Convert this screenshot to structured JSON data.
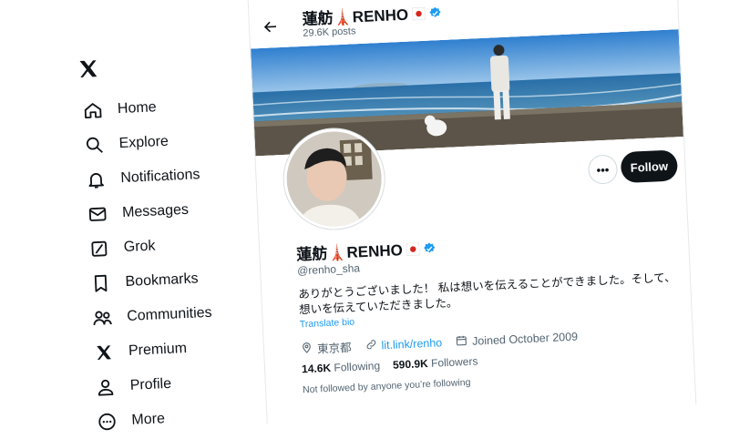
{
  "nav": {
    "items": [
      {
        "label": "Home",
        "icon": "home-icon"
      },
      {
        "label": "Explore",
        "icon": "search-icon"
      },
      {
        "label": "Notifications",
        "icon": "bell-icon"
      },
      {
        "label": "Messages",
        "icon": "envelope-icon"
      },
      {
        "label": "Grok",
        "icon": "grok-icon"
      },
      {
        "label": "Bookmarks",
        "icon": "bookmark-icon"
      },
      {
        "label": "Communities",
        "icon": "communities-icon"
      },
      {
        "label": "Premium",
        "icon": "x-icon"
      },
      {
        "label": "Profile",
        "icon": "person-icon"
      },
      {
        "label": "More",
        "icon": "more-circle-icon"
      }
    ]
  },
  "profile": {
    "top_name": "蓮舫🗼RENHO",
    "posts_count": "29.6K posts",
    "name": "蓮舫🗼RENHO",
    "handle": "@renho_sha",
    "bio": "ありがとうございました！ 私は想いを伝えることができました。そして、想いを伝えていただきました。",
    "translate_label": "Translate bio",
    "location": "東京都",
    "link": "lit.link/renho",
    "joined": "Joined October 2009",
    "following_count": "14.6K",
    "following_label": "Following",
    "followers_count": "590.9K",
    "followers_label": "Followers",
    "not_followed": "Not followed by anyone you’re following",
    "follow_label": "Follow",
    "more_label": "•••"
  },
  "colors": {
    "accent": "#1d9bf0",
    "verified": "#1d9bf0",
    "text": "#0f1419",
    "muted": "#536471"
  }
}
